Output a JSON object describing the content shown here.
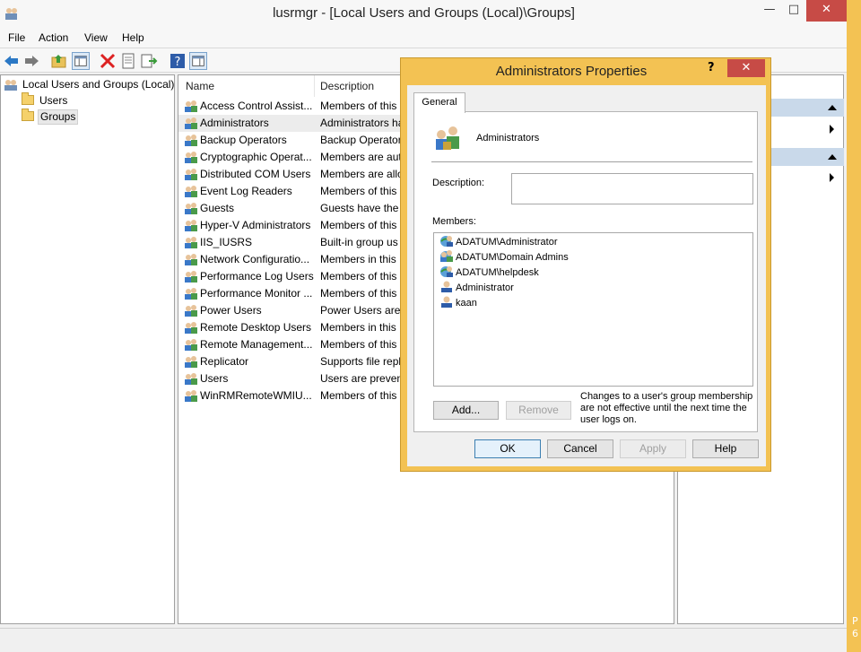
{
  "window": {
    "title": "lusrmgr - [Local Users and Groups (Local)\\Groups]",
    "minimize": "—",
    "maximize": "□",
    "close": "✕"
  },
  "menu": [
    "File",
    "Action",
    "View",
    "Help"
  ],
  "toolbar_icons": [
    "back-arrow-icon",
    "forward-arrow-icon",
    "up-folder-icon",
    "show-hide-tree-icon",
    "delete-icon",
    "properties-icon",
    "export-list-icon",
    "help-icon",
    "show-hide-action-pane-icon"
  ],
  "tree": {
    "root": "Local Users and Groups (Local)",
    "children": [
      "Users",
      "Groups"
    ],
    "selected": "Groups"
  },
  "list": {
    "columns": [
      "Name",
      "Description"
    ],
    "rows": [
      {
        "name": "Access Control Assist...",
        "desc": "Members of this"
      },
      {
        "name": "Administrators",
        "desc": "Administrators ha"
      },
      {
        "name": "Backup Operators",
        "desc": "Backup Operator"
      },
      {
        "name": "Cryptographic Operat...",
        "desc": "Members are aut"
      },
      {
        "name": "Distributed COM Users",
        "desc": "Members are allo"
      },
      {
        "name": "Event Log Readers",
        "desc": "Members of this"
      },
      {
        "name": "Guests",
        "desc": "Guests have the s"
      },
      {
        "name": "Hyper-V Administrators",
        "desc": "Members of this"
      },
      {
        "name": "IIS_IUSRS",
        "desc": "Built-in group us"
      },
      {
        "name": "Network Configuratio...",
        "desc": "Members in this"
      },
      {
        "name": "Performance Log Users",
        "desc": "Members of this"
      },
      {
        "name": "Performance Monitor ...",
        "desc": "Members of this"
      },
      {
        "name": "Power Users",
        "desc": "Power Users are i"
      },
      {
        "name": "Remote Desktop Users",
        "desc": "Members in this"
      },
      {
        "name": "Remote Management...",
        "desc": "Members of this"
      },
      {
        "name": "Replicator",
        "desc": "Supports file repl"
      },
      {
        "name": "Users",
        "desc": "Users are prevent"
      },
      {
        "name": "WinRMRemoteWMIU...",
        "desc": "Members of this"
      }
    ],
    "selected_index": 1
  },
  "side_text": "P",
  "side_text2": "6",
  "dialog": {
    "title": "Administrators Properties",
    "help": "?",
    "close": "✕",
    "tab": "General",
    "group_name": "Administrators",
    "description_label": "Description:",
    "description_value": "",
    "members_label": "Members:",
    "members": [
      {
        "name": "ADATUM\\Administrator",
        "icon": "domain-user-icon"
      },
      {
        "name": "ADATUM\\Domain Admins",
        "icon": "domain-group-icon"
      },
      {
        "name": "ADATUM\\helpdesk",
        "icon": "domain-user-icon"
      },
      {
        "name": "Administrator",
        "icon": "local-user-icon"
      },
      {
        "name": "kaan",
        "icon": "local-user-icon"
      }
    ],
    "add_button": "Add...",
    "remove_button": "Remove",
    "note": "Changes to a user's group membership are not effective until the next time the user logs on.",
    "ok": "OK",
    "cancel": "Cancel",
    "apply": "Apply",
    "help_button": "Help"
  },
  "colors": {
    "accent": "#f3c253",
    "close_red": "#c74b46",
    "action_header": "#c9d9ea"
  }
}
